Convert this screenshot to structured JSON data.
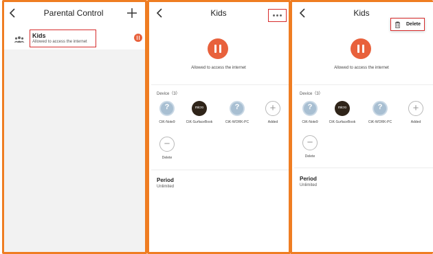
{
  "accent_color": "#e8613c",
  "highlight_color": "#d62a2a",
  "screens": [
    {
      "header": {
        "title": "Parental Control",
        "back_icon": "back-chevron-icon",
        "add_icon": "plus-icon"
      },
      "profile_row": {
        "icon": "group-icon",
        "name": "Kids",
        "status": "Allowed to access the internet",
        "state_icon": "pause-icon"
      }
    },
    {
      "header": {
        "title": "Kids",
        "back_icon": "back-chevron-icon",
        "menu_icon": "more-dots-icon"
      },
      "status": "Allowed to access the internet",
      "device_label": "Device（3）",
      "devices": [
        {
          "name": "CtK-Note9",
          "icon": "question-icon"
        },
        {
          "name": "CtK-SurfaceBook",
          "icon": "micro-badge",
          "badge": "micro"
        },
        {
          "name": "CtK-WORK-PC",
          "icon": "question-icon"
        },
        {
          "name": "Added",
          "icon": "plus-icon"
        },
        {
          "name": "Delete",
          "icon": "minus-icon"
        }
      ],
      "period": {
        "title": "Period",
        "value": "Unlimited"
      }
    },
    {
      "header": {
        "title": "Kids",
        "back_icon": "back-chevron-icon"
      },
      "popup": {
        "label": "Delete",
        "icon": "trash-icon"
      },
      "status": "Allowed to access the internet",
      "device_label": "Device（3）",
      "devices": [
        {
          "name": "CtK-Note9",
          "icon": "question-icon"
        },
        {
          "name": "CtK-SurfaceBook",
          "icon": "micro-badge",
          "badge": "micro"
        },
        {
          "name": "CtK-WORK-PC",
          "icon": "question-icon"
        },
        {
          "name": "Added",
          "icon": "plus-icon"
        },
        {
          "name": "Delete",
          "icon": "minus-icon"
        }
      ],
      "period": {
        "title": "Period",
        "value": "Unlimited"
      }
    }
  ]
}
